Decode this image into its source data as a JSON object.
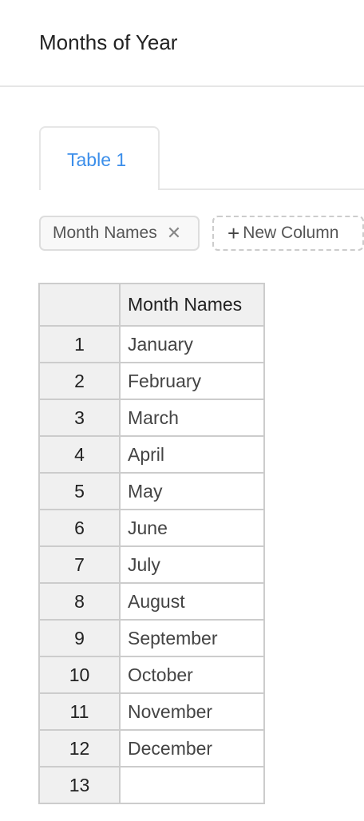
{
  "header": {
    "title": "Months of Year"
  },
  "tabs": [
    {
      "label": "Table 1",
      "active": true
    }
  ],
  "accent_color": "#3b8eea",
  "columns_bar": {
    "chips": [
      {
        "label": "Month Names",
        "remove_icon": "close-icon"
      }
    ],
    "new_column_label": "New Column",
    "new_column_icon": "plus-icon"
  },
  "table": {
    "headers": [
      "",
      "Month Names"
    ],
    "rows": [
      [
        "1",
        "January"
      ],
      [
        "2",
        "February"
      ],
      [
        "3",
        "March"
      ],
      [
        "4",
        "April"
      ],
      [
        "5",
        "May"
      ],
      [
        "6",
        "June"
      ],
      [
        "7",
        "July"
      ],
      [
        "8",
        "August"
      ],
      [
        "9",
        "September"
      ],
      [
        "10",
        "October"
      ],
      [
        "11",
        "November"
      ],
      [
        "12",
        "December"
      ],
      [
        "13",
        ""
      ]
    ]
  }
}
